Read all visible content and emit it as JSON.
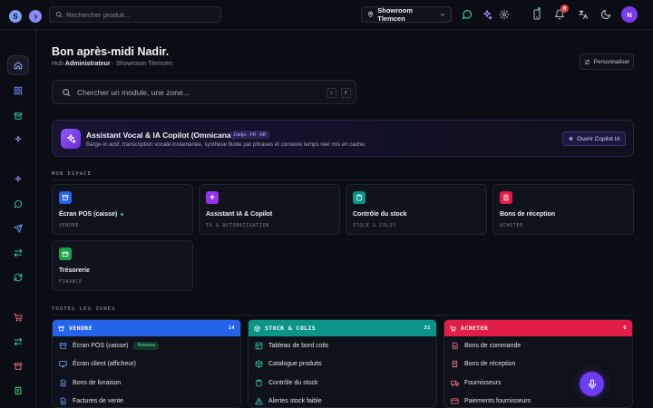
{
  "topbar": {
    "logo_letter": "S",
    "search_placeholder": "Rechercher produit...",
    "showroom_label": "Showroom Tlemcen",
    "notification_count": "8",
    "user_initial": "N"
  },
  "header": {
    "greeting": "Bon après-midi Nadir.",
    "breadcrumb_hub": "Hub",
    "breadcrumb_role": "Administrateur",
    "breadcrumb_sep": "·",
    "breadcrumb_location": "Showroom Tlemcen",
    "customize_label": "Personnaliser"
  },
  "search": {
    "placeholder": "Chercher un module, une zone...",
    "kbd_keys": [
      "⇧",
      "K"
    ]
  },
  "copilot": {
    "title": "Assistant Vocal & IA Copilot (Omnicanal)",
    "badge": "Darija · FR · AR",
    "description": "Barge-in actif, transcription vocale instantanée, synthèse fluide par phrases et contexte temps réel mis en cache.",
    "button_label": "Ouvrir Copilot IA"
  },
  "my_space": {
    "label": "MON ESPACE",
    "modules": [
      {
        "title": "Écran POS (caisse)",
        "sub": "VENDRE",
        "color": "#2563eb"
      },
      {
        "title": "Assistant IA & Copilot",
        "sub": "IA & AUTOMATISATION",
        "color": "#9333ea"
      },
      {
        "title": "Contrôle du stock",
        "sub": "STOCK & COLIS",
        "color": "#0d9488"
      },
      {
        "title": "Bons de réception",
        "sub": "ACHETER",
        "color": "#e11d48"
      },
      {
        "title": "Trésorerie",
        "sub": "FINANCE",
        "color": "#16a34a"
      }
    ]
  },
  "zones": {
    "label": "TOUTES LES ZONES",
    "list": [
      {
        "name": "VENDRE",
        "count": "14",
        "color": "#2563eb",
        "items": [
          {
            "label": "Écran POS (caisse)",
            "badge": "Nouveau"
          },
          {
            "label": "Écran client (afficheur)"
          },
          {
            "label": "Bons de livraison"
          },
          {
            "label": "Factures de vente"
          }
        ]
      },
      {
        "name": "STOCK & COLIS",
        "count": "21",
        "color": "#0d9488",
        "items": [
          {
            "label": "Tableau de bord colis"
          },
          {
            "label": "Catalogue produits"
          },
          {
            "label": "Contrôle du stock"
          },
          {
            "label": "Alertes stock faible"
          }
        ]
      },
      {
        "name": "ACHETER",
        "count": "6",
        "color": "#e11d48",
        "items": [
          {
            "label": "Bons de commande"
          },
          {
            "label": "Bons de réception"
          },
          {
            "label": "Fournisseurs"
          },
          {
            "label": "Paiements fournisseurs"
          }
        ]
      }
    ]
  },
  "colors": {
    "background": "#0b0d14",
    "accent": "#7c3aed",
    "card": "#10131b"
  }
}
